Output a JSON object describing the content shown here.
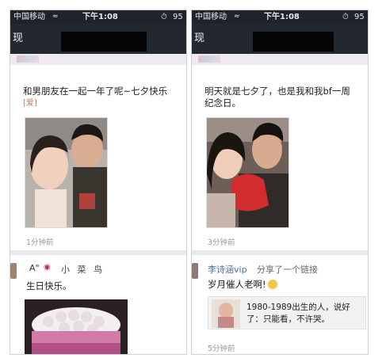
{
  "statusbar": {
    "carrier": "中国移动",
    "time": "下午1:08",
    "battery": "95"
  },
  "navbar": {
    "back_label": "现"
  },
  "left": {
    "post1": {
      "text": "和男朋友在一起一年了呢~七夕快乐",
      "emoticons": "[爱]",
      "time": "1分钟前"
    },
    "post2": {
      "author": "A\"",
      "author_suffix": "小 菜 鸟",
      "text": "生日快乐。"
    }
  },
  "right": {
    "post1": {
      "text": "明天就是七夕了，也是我和我bf一周",
      "text_line2": "纪念日。",
      "time": "3分钟前"
    },
    "post2": {
      "author": "李诗涵vip",
      "action": "分享了一个链接",
      "text": "岁月催人老啊!",
      "link_title": "1980-1989出生的人，说好",
      "link_title2": "了：只能看，不许哭。",
      "time": "5分钟前"
    }
  },
  "icons": {
    "wifi": "wifi-icon",
    "alarm": "alarm-icon",
    "lips": "lips-icon",
    "laugh": "laugh-emoji-icon"
  },
  "colors": {
    "navbar": "#23272f",
    "link": "#4a6fa5",
    "timestamp": "#999999"
  }
}
